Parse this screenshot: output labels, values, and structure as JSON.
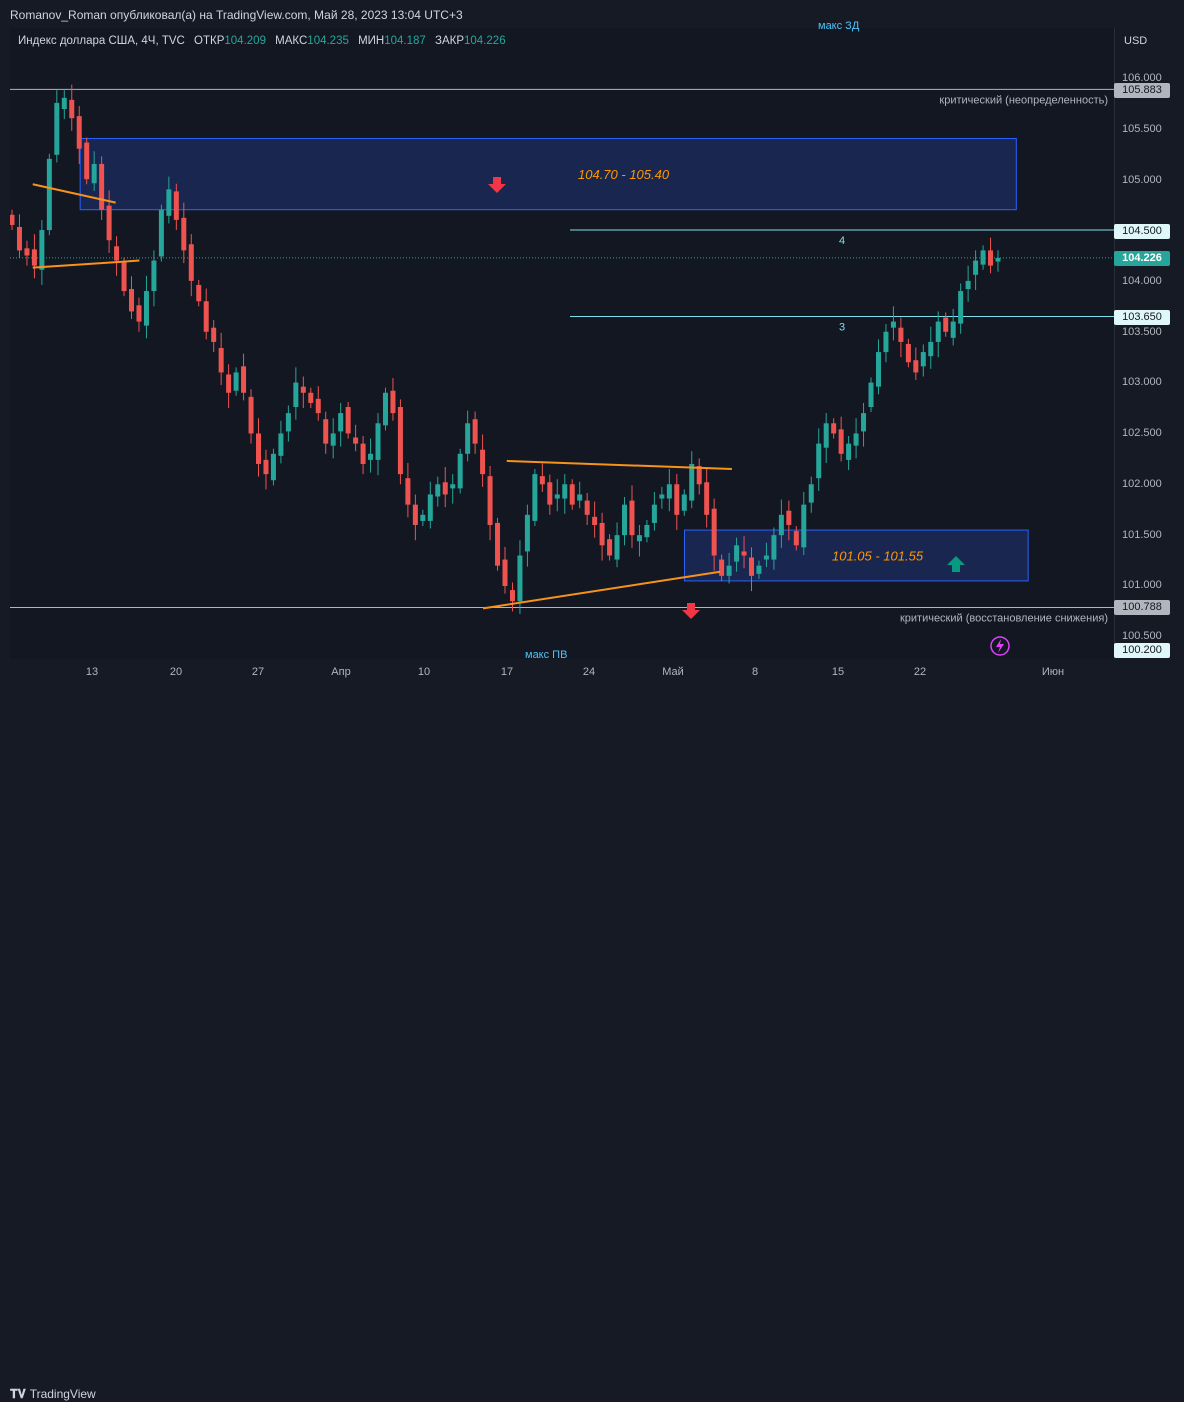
{
  "header": {
    "author_line": "Romanov_Roman опубликовал(а) на TradingView.com, Май 28, 2023 13:04 UTC+3"
  },
  "legend": {
    "symbol": "Индекс доллара США, 4Ч, TVC",
    "open_label": "ОТКР",
    "open_value": "104.209",
    "high_label": "МАКС",
    "high_value": "104.235",
    "low_label": "МИН",
    "low_value": "104.187",
    "close_label": "ЗАКР",
    "close_value": "104.226"
  },
  "notes": {
    "top": "макс ЗД",
    "bottom": "макс ПВ"
  },
  "axis": {
    "currency": "USD",
    "y_ticks": [
      "106.000",
      "105.500",
      "105.000",
      "104.000",
      "103.500",
      "103.000",
      "102.500",
      "102.000",
      "101.500",
      "101.000",
      "100.500"
    ],
    "x_ticks": [
      "13",
      "20",
      "27",
      "Апр",
      "10",
      "17",
      "24",
      "Май",
      "8",
      "15",
      "22",
      "Июн"
    ]
  },
  "price_badges": [
    {
      "label": "105.883",
      "kind": "level"
    },
    {
      "label": "104.500",
      "kind": "level"
    },
    {
      "label": "104.226",
      "kind": "last"
    },
    {
      "label": "103.650",
      "kind": "level"
    },
    {
      "label": "100.788",
      "kind": "level"
    },
    {
      "label": "100.200",
      "kind": "level"
    }
  ],
  "annotations": {
    "critical_upper": "критический (неопределенность)",
    "critical_lower": "критический (восстановление снижения)",
    "zone_upper": "104.70 - 105.40",
    "zone_lower": "101.05 - 101.55",
    "level_4": "4",
    "level_3": "3"
  },
  "footer": {
    "brand": "TradingView"
  },
  "colors": {
    "background": "#131722",
    "up": "#26a69a",
    "down": "#ef5350",
    "zone_fill": "#1e3a8a",
    "zone_border": "#2962ff",
    "trendline": "#f7931a",
    "level_line": "#80deea",
    "critical_line": "#b2b5be",
    "zone_text": "#ff9800"
  },
  "chart_data": {
    "type": "candlestick",
    "title": "",
    "ylabel": "USD",
    "ylim": [
      100.3,
      106.1
    ],
    "x_dates": [
      "2023-03-08",
      "2023-06-02"
    ],
    "horizontal_levels": [
      105.883,
      104.5,
      103.65,
      100.788
    ],
    "zones": [
      {
        "low": 104.7,
        "high": 105.4,
        "from": "2023-03-12",
        "to": "2023-05-30",
        "direction": "down"
      },
      {
        "low": 101.05,
        "high": 101.55,
        "from": "2023-05-02",
        "to": "2023-05-31",
        "direction": "up"
      }
    ],
    "trendlines": [
      {
        "from": [
          "2023-03-08",
          104.95
        ],
        "to": [
          "2023-03-15",
          104.77
        ]
      },
      {
        "from": [
          "2023-03-08",
          104.13
        ],
        "to": [
          "2023-03-17",
          104.2
        ]
      },
      {
        "from": [
          "2023-04-17",
          102.23
        ],
        "to": [
          "2023-05-06",
          102.15
        ]
      },
      {
        "from": [
          "2023-04-15",
          100.78
        ],
        "to": [
          "2023-05-05",
          101.14
        ]
      }
    ],
    "last_price": 104.226,
    "closes": [
      104.55,
      104.3,
      104.25,
      104.15,
      104.5,
      105.2,
      105.75,
      105.8,
      105.6,
      105.3,
      105.0,
      105.15,
      104.7,
      104.4,
      104.2,
      103.9,
      103.7,
      103.6,
      103.9,
      104.2,
      104.7,
      104.9,
      104.6,
      104.3,
      104.0,
      103.8,
      103.5,
      103.4,
      103.1,
      102.9,
      103.1,
      102.9,
      102.5,
      102.2,
      102.1,
      102.3,
      102.5,
      102.7,
      103.0,
      102.9,
      102.8,
      102.7,
      102.4,
      102.5,
      102.7,
      102.5,
      102.4,
      102.2,
      102.3,
      102.6,
      102.9,
      102.7,
      102.1,
      101.8,
      101.6,
      101.7,
      101.9,
      102.0,
      101.9,
      102.0,
      102.3,
      102.6,
      102.4,
      102.1,
      101.6,
      101.2,
      101.0,
      100.85,
      101.3,
      101.7,
      102.1,
      102.0,
      101.8,
      101.9,
      102.0,
      101.8,
      101.9,
      101.7,
      101.6,
      101.4,
      101.3,
      101.5,
      101.8,
      101.5,
      101.5,
      101.6,
      101.8,
      101.9,
      102.0,
      101.7,
      101.9,
      102.2,
      102.0,
      101.7,
      101.3,
      101.1,
      101.2,
      101.4,
      101.3,
      101.1,
      101.2,
      101.3,
      101.5,
      101.7,
      101.6,
      101.4,
      101.8,
      102.0,
      102.4,
      102.6,
      102.5,
      102.3,
      102.4,
      102.5,
      102.7,
      103.0,
      103.3,
      103.5,
      103.6,
      103.4,
      103.2,
      103.1,
      103.3,
      103.4,
      103.6,
      103.5,
      103.6,
      103.9,
      104.0,
      104.2,
      104.3,
      104.15,
      104.226
    ]
  }
}
